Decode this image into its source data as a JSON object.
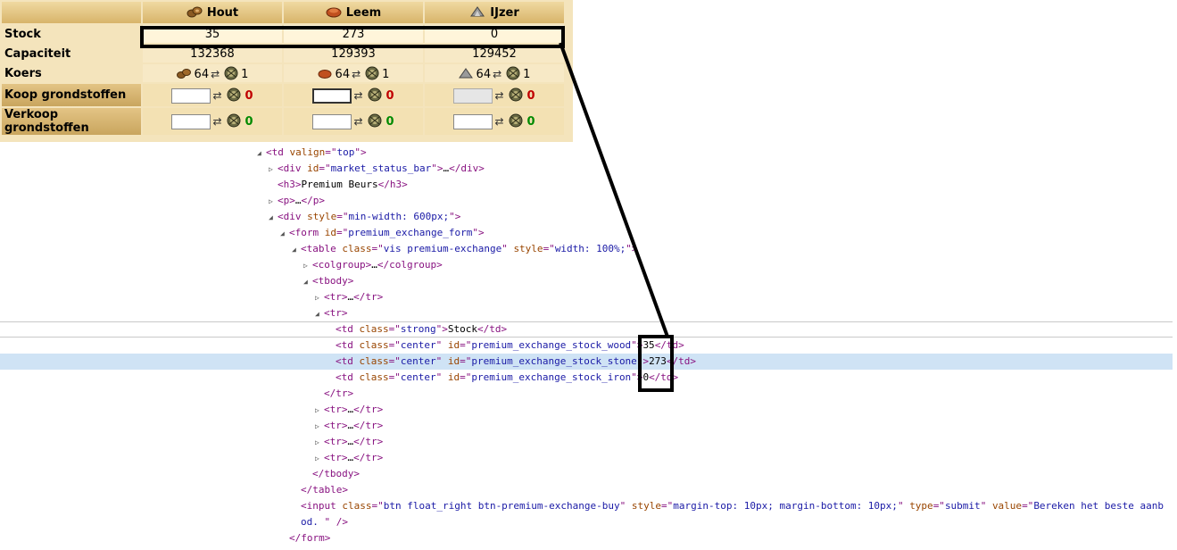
{
  "game": {
    "resources": [
      {
        "name": "Hout",
        "icon": "wood-icon"
      },
      {
        "name": "Leem",
        "icon": "clay-icon"
      },
      {
        "name": "IJzer",
        "icon": "iron-icon"
      }
    ],
    "rows": {
      "stock": {
        "label": "Stock",
        "values": [
          "35",
          "273",
          "0"
        ]
      },
      "capacity": {
        "label": "Capaciteit",
        "values": [
          "132368",
          "129393",
          "129452"
        ]
      },
      "rate": {
        "label": "Koers",
        "amount": "64",
        "arrow": "⇄",
        "premium": "1"
      },
      "buy": {
        "label": "Koop grondstoffen",
        "result": "0"
      },
      "sell": {
        "label": "Verkoop grondstoffen",
        "result": "0"
      }
    }
  },
  "dom_tree": [
    {
      "indent": 0,
      "tw": "open",
      "parts": [
        [
          "tag",
          "<td "
        ],
        [
          "an",
          "valign"
        ],
        [
          "tag",
          "=\""
        ],
        [
          "av",
          "top"
        ],
        [
          "tag",
          "\">"
        ]
      ]
    },
    {
      "indent": 1,
      "tw": "closed",
      "parts": [
        [
          "tag",
          "<div "
        ],
        [
          "an",
          "id"
        ],
        [
          "tag",
          "=\""
        ],
        [
          "av",
          "market_status_bar"
        ],
        [
          "tag",
          "\">"
        ],
        [
          "txt",
          "…"
        ],
        [
          "tag",
          "</div>"
        ]
      ]
    },
    {
      "indent": 1,
      "tw": "none",
      "parts": [
        [
          "tag",
          "<h3>"
        ],
        [
          "txt",
          "Premium Beurs"
        ],
        [
          "tag",
          "</h3>"
        ]
      ]
    },
    {
      "indent": 1,
      "tw": "closed",
      "parts": [
        [
          "tag",
          "<p>"
        ],
        [
          "txt",
          "…"
        ],
        [
          "tag",
          "</p>"
        ]
      ]
    },
    {
      "indent": 1,
      "tw": "open",
      "parts": [
        [
          "tag",
          "<div "
        ],
        [
          "an",
          "style"
        ],
        [
          "tag",
          "=\""
        ],
        [
          "av",
          "min-width: 600px;"
        ],
        [
          "tag",
          "\">"
        ]
      ]
    },
    {
      "indent": 2,
      "tw": "open",
      "parts": [
        [
          "tag",
          "<form "
        ],
        [
          "an",
          "id"
        ],
        [
          "tag",
          "=\""
        ],
        [
          "av",
          "premium_exchange_form"
        ],
        [
          "tag",
          "\">"
        ]
      ]
    },
    {
      "indent": 3,
      "tw": "open",
      "parts": [
        [
          "tag",
          "<table "
        ],
        [
          "an",
          "class"
        ],
        [
          "tag",
          "=\""
        ],
        [
          "av",
          "vis premium-exchange"
        ],
        [
          "tag",
          "\" "
        ],
        [
          "an",
          "style"
        ],
        [
          "tag",
          "=\""
        ],
        [
          "av",
          "width: 100%;"
        ],
        [
          "tag",
          "\">"
        ]
      ]
    },
    {
      "indent": 4,
      "tw": "closed",
      "parts": [
        [
          "tag",
          "<colgroup>"
        ],
        [
          "txt",
          "…"
        ],
        [
          "tag",
          "</colgroup>"
        ]
      ]
    },
    {
      "indent": 4,
      "tw": "open",
      "parts": [
        [
          "tag",
          "<tbody>"
        ]
      ]
    },
    {
      "indent": 5,
      "tw": "closed",
      "parts": [
        [
          "tag",
          "<tr>"
        ],
        [
          "txt",
          "…"
        ],
        [
          "tag",
          "</tr>"
        ]
      ]
    },
    {
      "indent": 5,
      "tw": "open",
      "parts": [
        [
          "tag",
          "<tr>"
        ]
      ]
    },
    {
      "indent": 6,
      "tw": "none",
      "parts": [
        [
          "tag",
          "<td "
        ],
        [
          "an",
          "class"
        ],
        [
          "tag",
          "=\""
        ],
        [
          "av",
          "strong"
        ],
        [
          "tag",
          "\">"
        ],
        [
          "txt",
          "Stock"
        ],
        [
          "tag",
          "</td>"
        ]
      ]
    },
    {
      "indent": 6,
      "tw": "none",
      "parts": [
        [
          "tag",
          "<td "
        ],
        [
          "an",
          "class"
        ],
        [
          "tag",
          "=\""
        ],
        [
          "av",
          "center"
        ],
        [
          "tag",
          "\" "
        ],
        [
          "an",
          "id"
        ],
        [
          "tag",
          "=\""
        ],
        [
          "av",
          "premium_exchange_stock_wood"
        ],
        [
          "tag",
          "\">"
        ],
        [
          "txt",
          "35"
        ],
        [
          "tag",
          "</td>"
        ]
      ]
    },
    {
      "indent": 6,
      "tw": "none",
      "sel": true,
      "parts": [
        [
          "tag",
          "<td "
        ],
        [
          "an",
          "class"
        ],
        [
          "tag",
          "=\""
        ],
        [
          "av",
          "center"
        ],
        [
          "tag",
          "\" "
        ],
        [
          "an",
          "id"
        ],
        [
          "tag",
          "=\""
        ],
        [
          "av",
          "premium_exchange_stock_stone"
        ],
        [
          "tag",
          "\">"
        ],
        [
          "txt",
          "273"
        ],
        [
          "tag",
          "</td>"
        ]
      ]
    },
    {
      "indent": 6,
      "tw": "none",
      "parts": [
        [
          "tag",
          "<td "
        ],
        [
          "an",
          "class"
        ],
        [
          "tag",
          "=\""
        ],
        [
          "av",
          "center"
        ],
        [
          "tag",
          "\" "
        ],
        [
          "an",
          "id"
        ],
        [
          "tag",
          "=\""
        ],
        [
          "av",
          "premium_exchange_stock_iron"
        ],
        [
          "tag",
          "\">"
        ],
        [
          "txt",
          "0"
        ],
        [
          "tag",
          "</td>"
        ]
      ]
    },
    {
      "indent": 5,
      "tw": "none",
      "parts": [
        [
          "tag",
          "</tr>"
        ]
      ]
    },
    {
      "indent": 5,
      "tw": "closed",
      "parts": [
        [
          "tag",
          "<tr>"
        ],
        [
          "txt",
          "…"
        ],
        [
          "tag",
          "</tr>"
        ]
      ]
    },
    {
      "indent": 5,
      "tw": "closed",
      "parts": [
        [
          "tag",
          "<tr>"
        ],
        [
          "txt",
          "…"
        ],
        [
          "tag",
          "</tr>"
        ]
      ]
    },
    {
      "indent": 5,
      "tw": "closed",
      "parts": [
        [
          "tag",
          "<tr>"
        ],
        [
          "txt",
          "…"
        ],
        [
          "tag",
          "</tr>"
        ]
      ]
    },
    {
      "indent": 5,
      "tw": "closed",
      "parts": [
        [
          "tag",
          "<tr>"
        ],
        [
          "txt",
          "…"
        ],
        [
          "tag",
          "</tr>"
        ]
      ]
    },
    {
      "indent": 4,
      "tw": "none",
      "parts": [
        [
          "tag",
          "</tbody>"
        ]
      ]
    },
    {
      "indent": 3,
      "tw": "none",
      "parts": [
        [
          "tag",
          "</table>"
        ]
      ]
    },
    {
      "indent": 3,
      "tw": "none",
      "parts": [
        [
          "tag",
          "<input "
        ],
        [
          "an",
          "class"
        ],
        [
          "tag",
          "=\""
        ],
        [
          "av",
          "btn float_right btn-premium-exchange-buy"
        ],
        [
          "tag",
          "\" "
        ],
        [
          "an",
          "style"
        ],
        [
          "tag",
          "=\""
        ],
        [
          "av",
          "margin-top: 10px; margin-bottom: 10px;"
        ],
        [
          "tag",
          "\" "
        ],
        [
          "an",
          "type"
        ],
        [
          "tag",
          "=\""
        ],
        [
          "av",
          "submit"
        ],
        [
          "tag",
          "\" "
        ],
        [
          "an",
          "value"
        ],
        [
          "tag",
          "=\""
        ],
        [
          "av",
          "Bereken het beste aanb"
        ]
      ]
    },
    {
      "indent": 3,
      "tw": "none",
      "parts": [
        [
          "av",
          "od. "
        ],
        [
          "tag",
          "\" />"
        ]
      ]
    },
    {
      "indent": 2,
      "tw": "none",
      "parts": [
        [
          "tag",
          "</form>"
        ]
      ]
    }
  ]
}
